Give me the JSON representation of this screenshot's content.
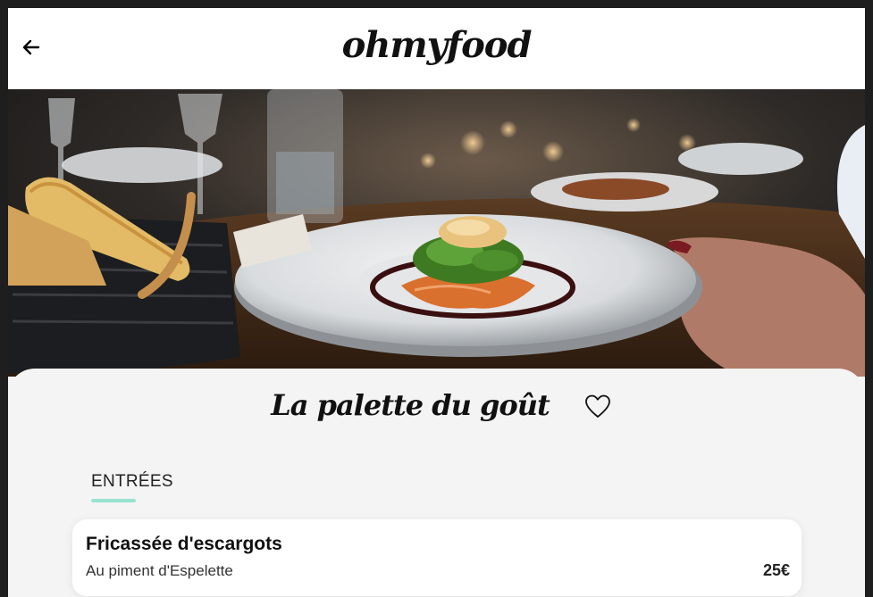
{
  "header": {
    "back_icon": "arrow-left-icon",
    "logo": "ohmyfood"
  },
  "hero": {
    "description_icon": "restaurant-dish-photo"
  },
  "restaurant": {
    "name": "La palette du goût",
    "favorite_icon": "heart-outline-icon"
  },
  "menu": {
    "sections": [
      {
        "label": "ENTRÉES",
        "items": [
          {
            "name": "Fricassée d'escargots",
            "description": "Au piment d'Espelette",
            "price": "25€"
          }
        ]
      }
    ]
  },
  "colors": {
    "accent": "#99e2d0",
    "background": "#f4f4f4",
    "card": "#ffffff"
  }
}
